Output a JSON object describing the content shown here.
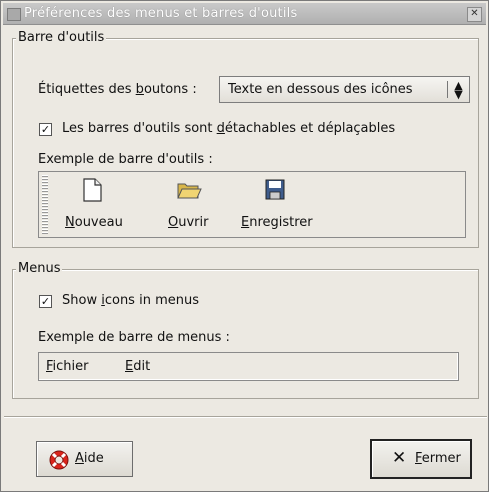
{
  "window": {
    "title": "Préférences des menus et barres d'outils",
    "close_glyph": "✕"
  },
  "toolbar_section": {
    "legend": "Barre d'outils",
    "labels_prefix": "Étiquettes des ",
    "labels_mnemonic": "b",
    "labels_suffix": "outons :",
    "combo_value": "Texte en dessous des icônes",
    "combo_arrow": "▲▼",
    "detachable_checked": true,
    "detachable_prefix": "Les barres d'outils sont ",
    "detachable_mnemonic": "d",
    "detachable_suffix": "étachables et déplaçables",
    "example_label": "Exemple de barre d'outils :",
    "buttons": [
      {
        "mnemonic": "N",
        "rest": "ouveau",
        "icon": "new-document-icon"
      },
      {
        "mnemonic": "O",
        "rest": "uvrir",
        "icon": "open-folder-icon"
      },
      {
        "mnemonic": "E",
        "rest": "nregistrer",
        "icon": "save-floppy-icon"
      }
    ]
  },
  "menus_section": {
    "legend": "Menus",
    "show_icons_checked": true,
    "show_icons_prefix": "Show ",
    "show_icons_mnemonic": "i",
    "show_icons_suffix": "cons in menus",
    "example_label": "Exemple de barre de menus :",
    "menu_items": [
      {
        "mnemonic": "F",
        "rest": "ichier"
      },
      {
        "mnemonic": "E",
        "rest": "dit"
      }
    ]
  },
  "footer": {
    "help_mnemonic": "A",
    "help_rest": "ide",
    "help_icon": "lifebuoy-icon",
    "close_mnemonic": "F",
    "close_rest": "ermer",
    "close_icon": "x-close-icon"
  },
  "colors": {
    "help_icon_red": "#d9251c",
    "folder_yellow": "#d8b64a",
    "floppy_blue": "#3f5d8d"
  }
}
